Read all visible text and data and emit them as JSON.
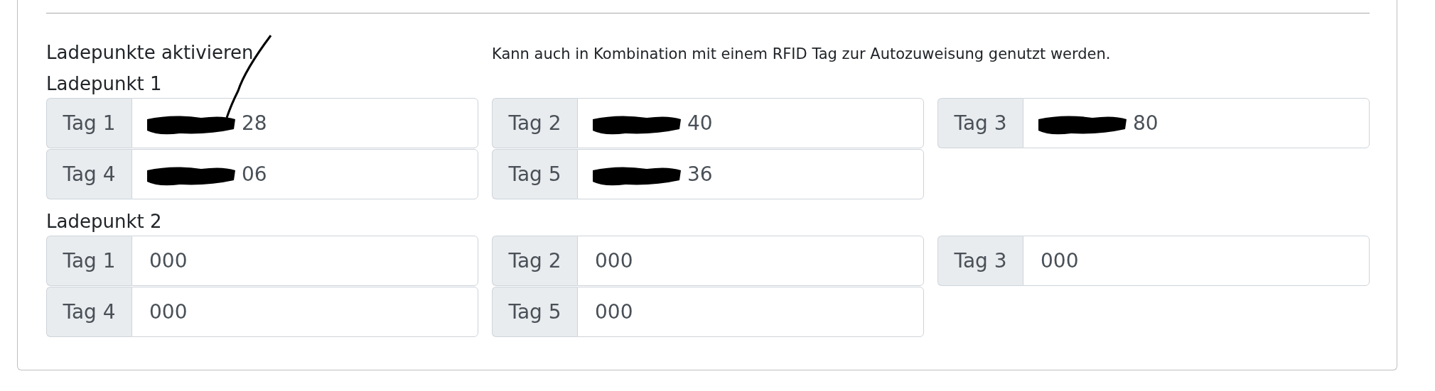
{
  "title": "Ladepunkte aktivieren",
  "hint": "Kann auch in Kombination mit einem RFID Tag zur Autozuweisung genutzt werden.",
  "charge_points": [
    {
      "label": "Ladepunkt 1",
      "tags": [
        {
          "label": "Tag 1",
          "value": "28",
          "redacted": true,
          "pen_stroke": true
        },
        {
          "label": "Tag 2",
          "value": "40",
          "redacted": true,
          "pen_stroke": false
        },
        {
          "label": "Tag 3",
          "value": "80",
          "redacted": true,
          "pen_stroke": false
        },
        {
          "label": "Tag 4",
          "value": "06",
          "redacted": true,
          "pen_stroke": false
        },
        {
          "label": "Tag 5",
          "value": "36",
          "redacted": true,
          "pen_stroke": false
        }
      ]
    },
    {
      "label": "Ladepunkt 2",
      "tags": [
        {
          "label": "Tag 1",
          "value": "000",
          "redacted": false,
          "pen_stroke": false
        },
        {
          "label": "Tag 2",
          "value": "000",
          "redacted": false,
          "pen_stroke": false
        },
        {
          "label": "Tag 3",
          "value": "000",
          "redacted": false,
          "pen_stroke": false
        },
        {
          "label": "Tag 4",
          "value": "000",
          "redacted": false,
          "pen_stroke": false
        },
        {
          "label": "Tag 5",
          "value": "000",
          "redacted": false,
          "pen_stroke": false
        }
      ]
    }
  ]
}
